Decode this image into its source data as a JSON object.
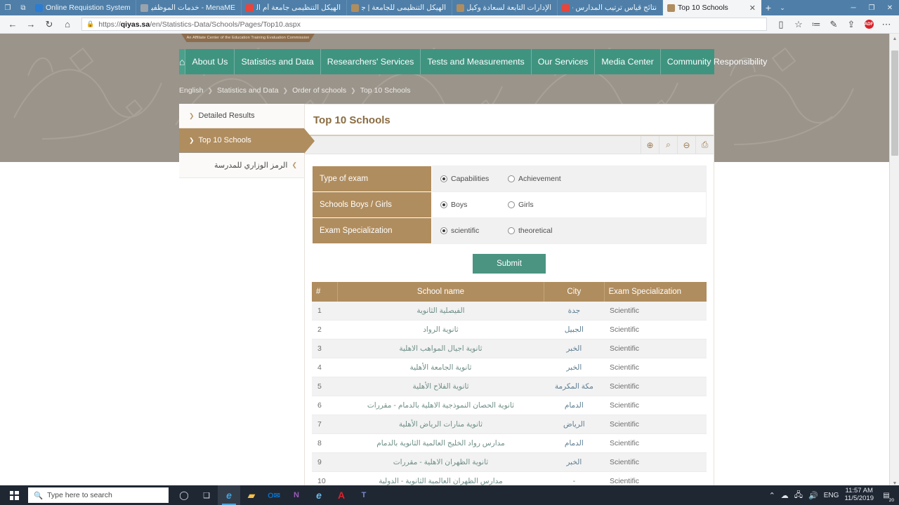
{
  "browser": {
    "tabs": [
      {
        "title": "Online Requistion System (",
        "favicon_color": "#2b7cd3",
        "rtl": false,
        "active": false
      },
      {
        "title": "MenaME - خدمات الموظفين",
        "favicon_color": "#7a7a7a",
        "rtl": true,
        "active": false
      },
      {
        "title": "الهيكل التنظيمى جامعة أم القر",
        "favicon_color": "#e8453c",
        "rtl": true,
        "active": false
      },
      {
        "title": "الهيكل التنظيمى للجامعة | جا",
        "favicon_color": "#b08d5e",
        "rtl": true,
        "active": false
      },
      {
        "title": "الإدارات التابعة لسعادة وكيل ا",
        "favicon_color": "#b08d5e",
        "rtl": true,
        "active": false
      },
      {
        "title": "نتائج قياس ترتيب المدارس - G",
        "favicon_color": "#e8453c",
        "rtl": true,
        "active": false
      },
      {
        "title": "Top 10 Schools",
        "favicon_color": "#b08d5e",
        "rtl": false,
        "active": true
      }
    ],
    "tab_close_label": "✕",
    "newtab_label": "+",
    "tabmenu_label": "⌄",
    "window_controls": [
      "─",
      "❐",
      "✕"
    ],
    "nav": {
      "back": "←",
      "forward": "→",
      "refresh": "↻",
      "home": "⌂"
    },
    "url": {
      "lock_icon": "lock-icon",
      "host": "qiyas.sa",
      "prefix": "https://",
      "path": "/en/Statistics-Data/Schools/Pages/Top10.aspx"
    },
    "toolbar_right": [
      "reading-list-icon",
      "favorite-star-icon",
      "notes-icon",
      "pen-icon",
      "share-icon",
      "adobe-icon",
      "more-icon"
    ],
    "adobe_label": "ADF",
    "more_label": "⋯"
  },
  "site": {
    "affiliate_banner": "An Affiliate Center of the Education Training Evaluation Commission",
    "nav_home_icon": "home-icon",
    "nav_items": [
      "About Us",
      "Statistics and Data",
      "Researchers' Services",
      "Tests and Measurements",
      "Our Services",
      "Media Center",
      "Community Responsibility"
    ],
    "breadcrumb": [
      "English",
      "Statistics and Data",
      "Order of schools",
      "Top 10 Schools"
    ],
    "breadcrumb_separator": "❯"
  },
  "sidebar": {
    "items": [
      {
        "label": "Detailed Results",
        "active": false,
        "rtl": false
      },
      {
        "label": "Top 10 Schools",
        "active": true,
        "rtl": false
      },
      {
        "label": "الرمز الوزاري للمدرسة",
        "active": false,
        "rtl": true
      }
    ],
    "chevron": "❯"
  },
  "panel": {
    "title": "Top 10 Schools",
    "toolbar_icons": [
      "zoom-in-icon",
      "search-icon",
      "zoom-out-icon",
      "print-icon"
    ],
    "toolbar_glyphs": [
      "⊕",
      "⌕",
      "⊖",
      "⎙"
    ]
  },
  "form": {
    "rows": [
      {
        "label": "Type of exam",
        "options": [
          {
            "label": "Capabilities",
            "selected": true
          },
          {
            "label": "Achievement",
            "selected": false
          }
        ]
      },
      {
        "label": "Schools Boys / Girls",
        "options": [
          {
            "label": "Boys",
            "selected": true
          },
          {
            "label": "Girls",
            "selected": false
          }
        ]
      },
      {
        "label": "Exam Specialization",
        "options": [
          {
            "label": "scientific",
            "selected": true
          },
          {
            "label": "theoretical",
            "selected": false
          }
        ]
      }
    ],
    "submit_label": "Submit"
  },
  "results": {
    "headers": [
      "#",
      "School name",
      "City",
      "Exam Specialization"
    ],
    "rows": [
      {
        "num": "1",
        "school": "الفيصلية الثانوية",
        "city": "جدة",
        "spec": "Scientific"
      },
      {
        "num": "2",
        "school": "ثانوية الرواد",
        "city": "الجبيل",
        "spec": "Scientific"
      },
      {
        "num": "3",
        "school": "ثانوية اجيال المواهب الاهلية",
        "city": "الخبر",
        "spec": "Scientific"
      },
      {
        "num": "4",
        "school": "ثانوية الجامعة الأهلية",
        "city": "الخبر",
        "spec": "Scientific"
      },
      {
        "num": "5",
        "school": "ثانوية الفلاح الأهلية",
        "city": "مكة المكرمة",
        "spec": "Scientific"
      },
      {
        "num": "6",
        "school": "ثانوية الحصان النموذجية الاهلية بالدمام - مقررات",
        "city": "الدمام",
        "spec": "Scientific"
      },
      {
        "num": "7",
        "school": "ثانوية منارات الرياض الأهلية",
        "city": "الرياض",
        "spec": "Scientific"
      },
      {
        "num": "8",
        "school": "مدارس رواد الخليج العالمية الثانوية بالدمام",
        "city": "الدمام",
        "spec": "Scientific"
      },
      {
        "num": "9",
        "school": "ثانوية الظهران الاهلية - مقررات",
        "city": "الخبر",
        "spec": "Scientific"
      },
      {
        "num": "10",
        "school": "مدارس الظهران العالمية الثانوية - الدولية",
        "city": "-",
        "spec": "Scientific"
      }
    ]
  },
  "taskbar": {
    "search_placeholder": "Type here to search",
    "search_icon": "search-icon",
    "start_icon": "windows-start-icon",
    "pinned": [
      {
        "name": "cortana-icon",
        "glyph": "◯"
      },
      {
        "name": "task-view-icon",
        "glyph": "❒"
      },
      {
        "name": "edge-icon",
        "glyph": "e",
        "color": "#3fa3e0",
        "active": true
      },
      {
        "name": "file-explorer-icon",
        "glyph": "▭",
        "color": "#f6c04a"
      },
      {
        "name": "outlook-icon",
        "glyph": "O",
        "color": "#0f6cbd"
      },
      {
        "name": "onenote-icon",
        "glyph": "N",
        "color": "#7a3f96"
      },
      {
        "name": "internet-explorer-icon",
        "glyph": "e",
        "color": "#69b9e8"
      },
      {
        "name": "acrobat-reader-icon",
        "glyph": "A",
        "color": "#d8232a"
      },
      {
        "name": "teams-icon",
        "glyph": "T",
        "color": "#5b5fc7"
      }
    ],
    "tray": {
      "chevron": "⌃",
      "onedrive_icon": "onedrive-icon",
      "network_icon": "network-icon",
      "volume_icon": "volume-icon",
      "language": "ENG",
      "time": "11:57 AM",
      "date": "11/5/2019",
      "notification_count": "20"
    }
  },
  "colors": {
    "nav_green": "#3f9480",
    "accent_tan": "#b08d5e",
    "title_brown": "#8a6c41",
    "submit_green": "#4a9481",
    "hero_grey": "#9a948b"
  }
}
